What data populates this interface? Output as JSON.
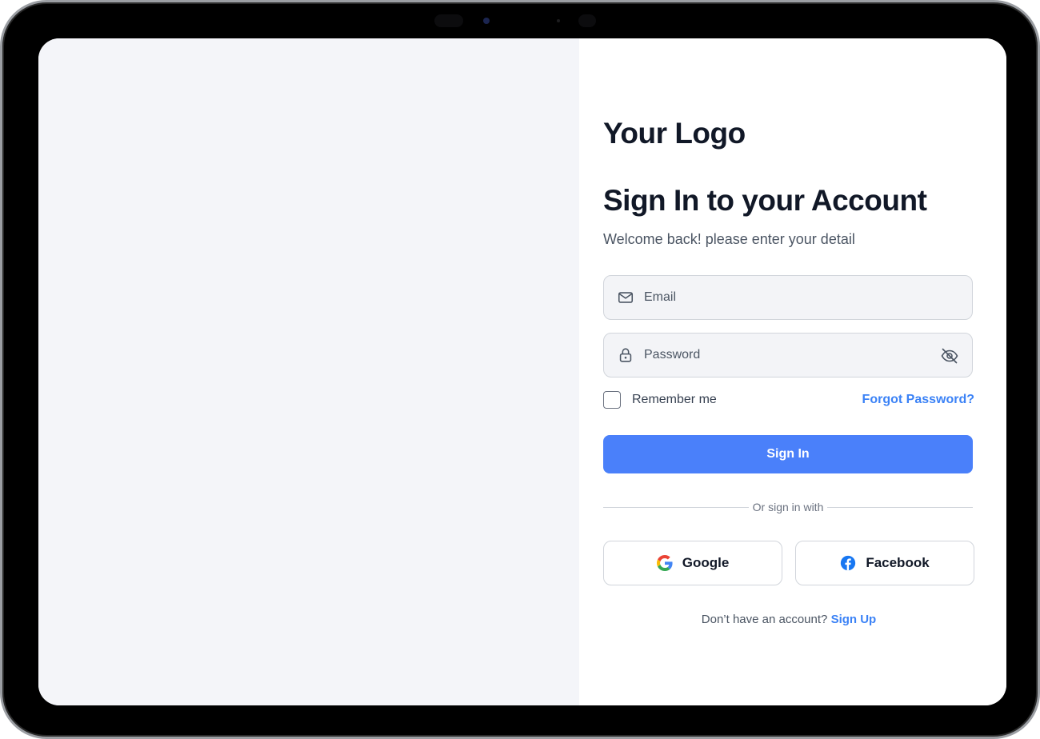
{
  "brand": {
    "logo_text": "Your Logo"
  },
  "heading": {
    "title": "Sign In to your Account",
    "subtitle": "Welcome back! please enter your detail"
  },
  "form": {
    "email": {
      "placeholder": "Email",
      "value": "",
      "icon": "mail-icon"
    },
    "password": {
      "placeholder": "Password",
      "value": "",
      "icon": "lock-icon",
      "toggle_icon": "eye-off-icon"
    },
    "remember_label": "Remember me",
    "remember_checked": false,
    "forgot_label": "Forgot Password?",
    "submit_label": "Sign In"
  },
  "divider_text": "Or sign in with",
  "social": {
    "google_label": "Google",
    "facebook_label": "Facebook"
  },
  "footer": {
    "prompt": "Don’t have an account?",
    "signup_label": "Sign Up"
  },
  "colors": {
    "accent": "#4a80fa",
    "link": "#3b82f6",
    "left_panel_bg": "#f4f5f9",
    "heading_text": "#111827",
    "facebook": "#1877f2"
  }
}
